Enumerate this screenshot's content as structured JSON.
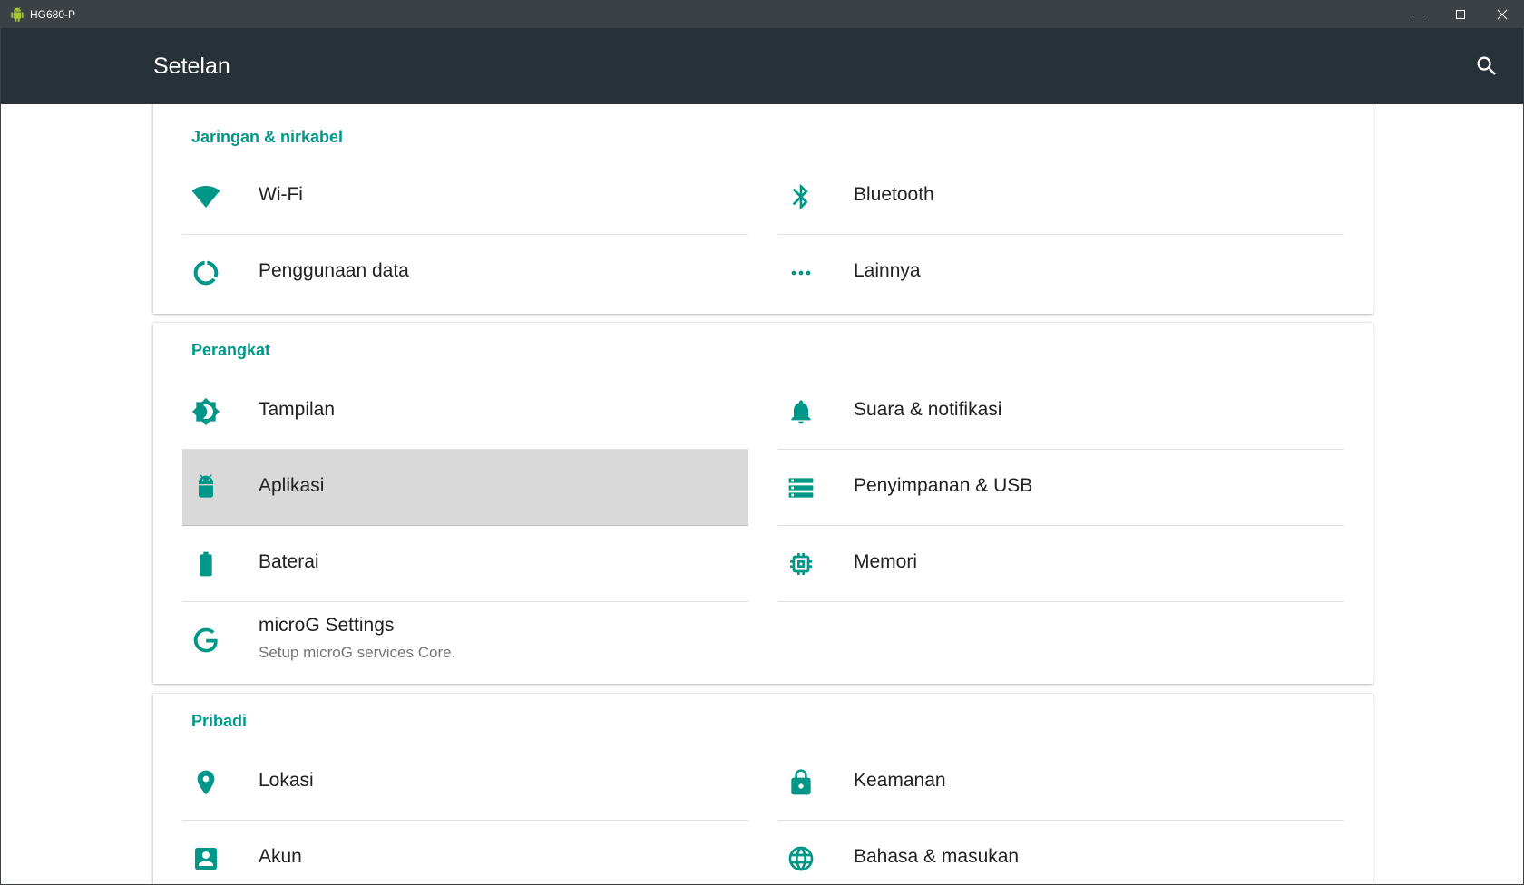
{
  "window": {
    "title": "HG680-P"
  },
  "actionbar": {
    "title": "Setelan"
  },
  "colors": {
    "accent": "#009688",
    "actionbar": "#263238",
    "titlebar": "#3c4146",
    "selected_row": "#d9d9d9"
  },
  "sections": {
    "wireless": {
      "title": "Jaringan & nirkabel",
      "items": [
        {
          "label": "Wi-Fi",
          "icon": "wifi-icon"
        },
        {
          "label": "Bluetooth",
          "icon": "bluetooth-icon"
        },
        {
          "label": "Penggunaan data",
          "icon": "data-usage-icon"
        },
        {
          "label": "Lainnya",
          "icon": "more-horiz-icon"
        }
      ]
    },
    "device": {
      "title": "Perangkat",
      "items": [
        {
          "label": "Tampilan",
          "icon": "brightness-icon"
        },
        {
          "label": "Suara & notifikasi",
          "icon": "bell-icon"
        },
        {
          "label": "Aplikasi",
          "icon": "android-icon",
          "selected": true
        },
        {
          "label": "Penyimpanan & USB",
          "icon": "storage-icon"
        },
        {
          "label": "Baterai",
          "icon": "battery-icon"
        },
        {
          "label": "Memori",
          "icon": "memory-chip-icon"
        },
        {
          "label": "microG Settings",
          "summary": "Setup microG services Core.",
          "icon": "google-g-icon"
        }
      ]
    },
    "personal": {
      "title": "Pribadi",
      "items": [
        {
          "label": "Lokasi",
          "icon": "location-pin-icon"
        },
        {
          "label": "Keamanan",
          "icon": "lock-icon"
        },
        {
          "label": "Akun",
          "icon": "account-box-icon"
        },
        {
          "label": "Bahasa & masukan",
          "icon": "globe-icon"
        }
      ]
    }
  }
}
